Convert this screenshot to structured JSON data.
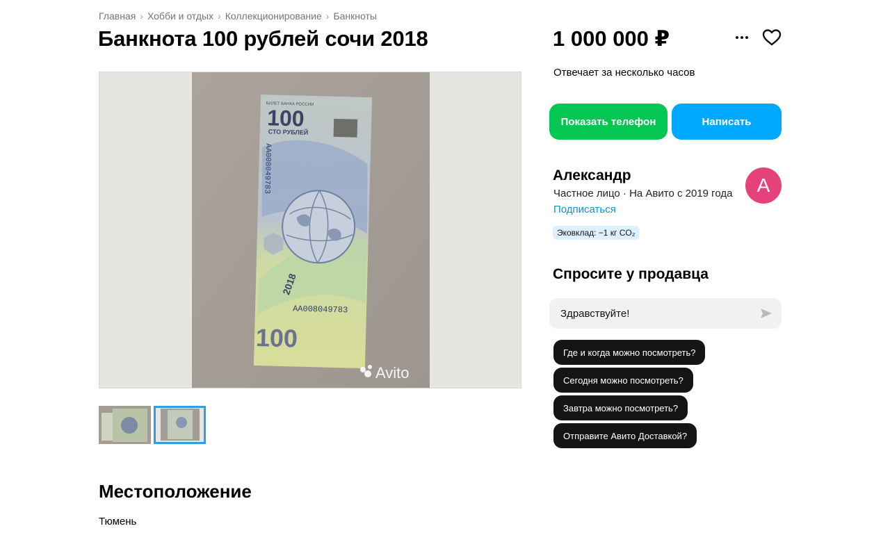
{
  "breadcrumb": {
    "items": [
      "Главная",
      "Хобби и отдых",
      "Коллекционирование",
      "Банкноты"
    ],
    "separator": "›"
  },
  "listing": {
    "title": "Банкнота 100 рублей сочи 2018",
    "price": "1 000 000 ₽",
    "reply_time": "Отвечает за несколько часов"
  },
  "gallery": {
    "banknote_denomination": "100",
    "banknote_caption": "СТО РУБЛЕЙ",
    "banknote_year": "2018",
    "banknote_serial": "АА008049783",
    "banknote_header": "БИЛЕТ БАНКА РОССИИ",
    "watermark": "Avito",
    "thumbnail_count": 2,
    "active_thumbnail": 2
  },
  "actions": {
    "show_phone": "Показать телефон",
    "write": "Написать"
  },
  "seller": {
    "name": "Александр",
    "meta": "Частное лицо · На Авито с 2019 года",
    "subscribe": "Подписаться",
    "eco_badge": "Эковклад: −1 кг CO₂",
    "avatar_letter": "А",
    "avatar_color": "#e5427b"
  },
  "ask": {
    "title": "Спросите у продавца",
    "input_value": "Здравствуйте!",
    "suggestions": [
      "Где и когда можно посмотреть?",
      "Сегодня можно посмотреть?",
      "Завтра можно посмотреть?",
      "Отправите Авито Доставкой?"
    ]
  },
  "location": {
    "title": "Местоположение",
    "city": "Тюмень"
  },
  "colors": {
    "green": "#04c653",
    "blue": "#00a9ff",
    "link": "#0a92dd"
  },
  "icons": {
    "more": "more-icon",
    "favorite": "heart-icon",
    "send": "send-icon"
  }
}
